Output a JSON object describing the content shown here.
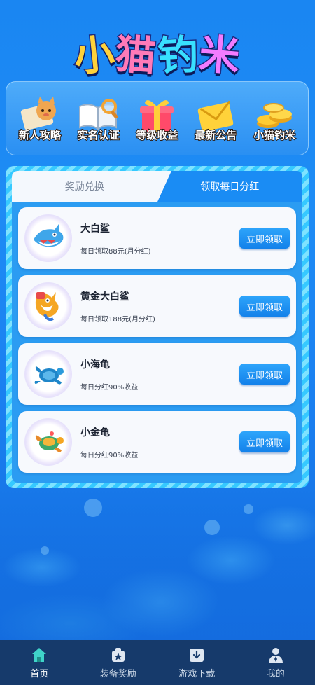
{
  "logo": {
    "chars": [
      "小",
      "猫",
      "钓",
      "米"
    ]
  },
  "menu": {
    "items": [
      {
        "label": "新人攻略",
        "icon": "guide-cat-icon"
      },
      {
        "label": "实名认证",
        "icon": "book-magnifier-icon"
      },
      {
        "label": "等级收益",
        "icon": "gift-box-icon"
      },
      {
        "label": "最新公告",
        "icon": "envelope-icon"
      },
      {
        "label": "小猫钓米",
        "icon": "gold-coins-icon"
      }
    ]
  },
  "tabs": {
    "inactive_label": "奖励兑换",
    "active_label": "领取每日分红"
  },
  "rewards": [
    {
      "title": "大白鲨",
      "desc": "每日领取88元(月分红)",
      "button": "立即领取",
      "icon": "shark-icon"
    },
    {
      "title": "黄金大白鲨",
      "desc": "每日领取188元(月分红)",
      "button": "立即领取",
      "icon": "golden-shark-icon"
    },
    {
      "title": "小海龟",
      "desc": "每日分红90%收益",
      "button": "立即领取",
      "icon": "sea-turtle-icon"
    },
    {
      "title": "小金龟",
      "desc": "每日分红90%收益",
      "button": "立即领取",
      "icon": "golden-turtle-icon"
    }
  ],
  "bottom_nav": [
    {
      "label": "首页",
      "icon": "home-icon",
      "active": true
    },
    {
      "label": "装备奖励",
      "icon": "equipment-icon",
      "active": false
    },
    {
      "label": "游戏下载",
      "icon": "download-icon",
      "active": false
    },
    {
      "label": "我的",
      "icon": "profile-icon",
      "active": false
    }
  ],
  "colors": {
    "background": "#1a86f2",
    "accent": "#1a8cf4",
    "nav_bg": "#163a6b",
    "active_nav_icon": "#3fd3c9"
  }
}
